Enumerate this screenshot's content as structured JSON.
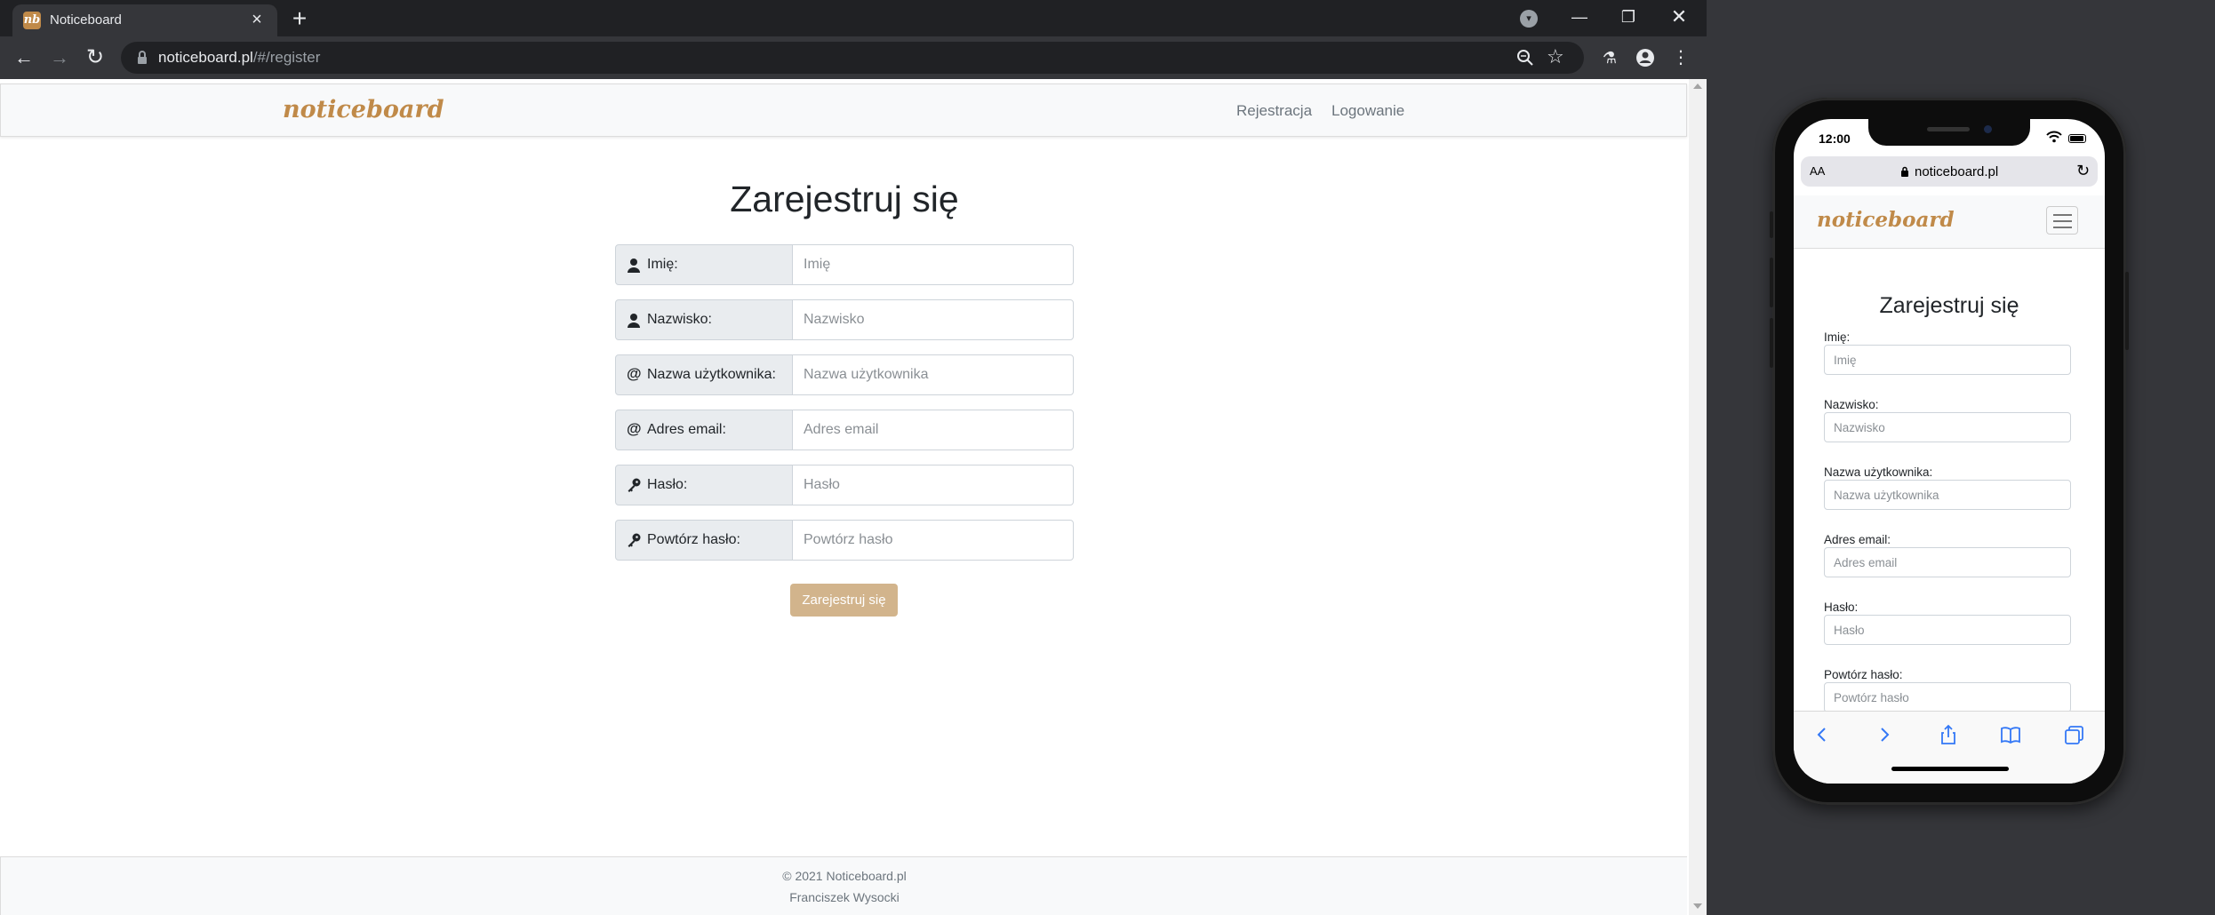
{
  "browser": {
    "tab_title": "Noticeboard",
    "favicon_text": "nb",
    "url_host": "noticeboard.pl",
    "url_path": "/#/register"
  },
  "site": {
    "brand": "noticeboard",
    "nav": {
      "register": "Rejestracja",
      "login": "Logowanie"
    },
    "title": "Zarejestruj się",
    "fields": [
      {
        "label": "Imię:",
        "placeholder": "Imię",
        "icon": "user-icon"
      },
      {
        "label": "Nazwisko:",
        "placeholder": "Nazwisko",
        "icon": "user-icon"
      },
      {
        "label": "Nazwa użytkownika:",
        "placeholder": "Nazwa użytkownika",
        "icon": "at-icon"
      },
      {
        "label": "Adres email:",
        "placeholder": "Adres email",
        "icon": "at-icon"
      },
      {
        "label": "Hasło:",
        "placeholder": "Hasło",
        "icon": "key-icon"
      },
      {
        "label": "Powtórz hasło:",
        "placeholder": "Powtórz hasło",
        "icon": "key-icon"
      }
    ],
    "submit": "Zarejestruj się",
    "footer": {
      "copyright": "© 2021 Noticeboard.pl",
      "author": "Franciszek Wysocki"
    }
  },
  "phone": {
    "time": "12:00",
    "safari_aa": "AA",
    "safari_url": "noticeboard.pl"
  },
  "colors": {
    "brand": "#c08a49",
    "submit_button": "#d2b48c",
    "addon_bg": "#e9ecef",
    "navbar_bg": "#f8f9fa"
  }
}
